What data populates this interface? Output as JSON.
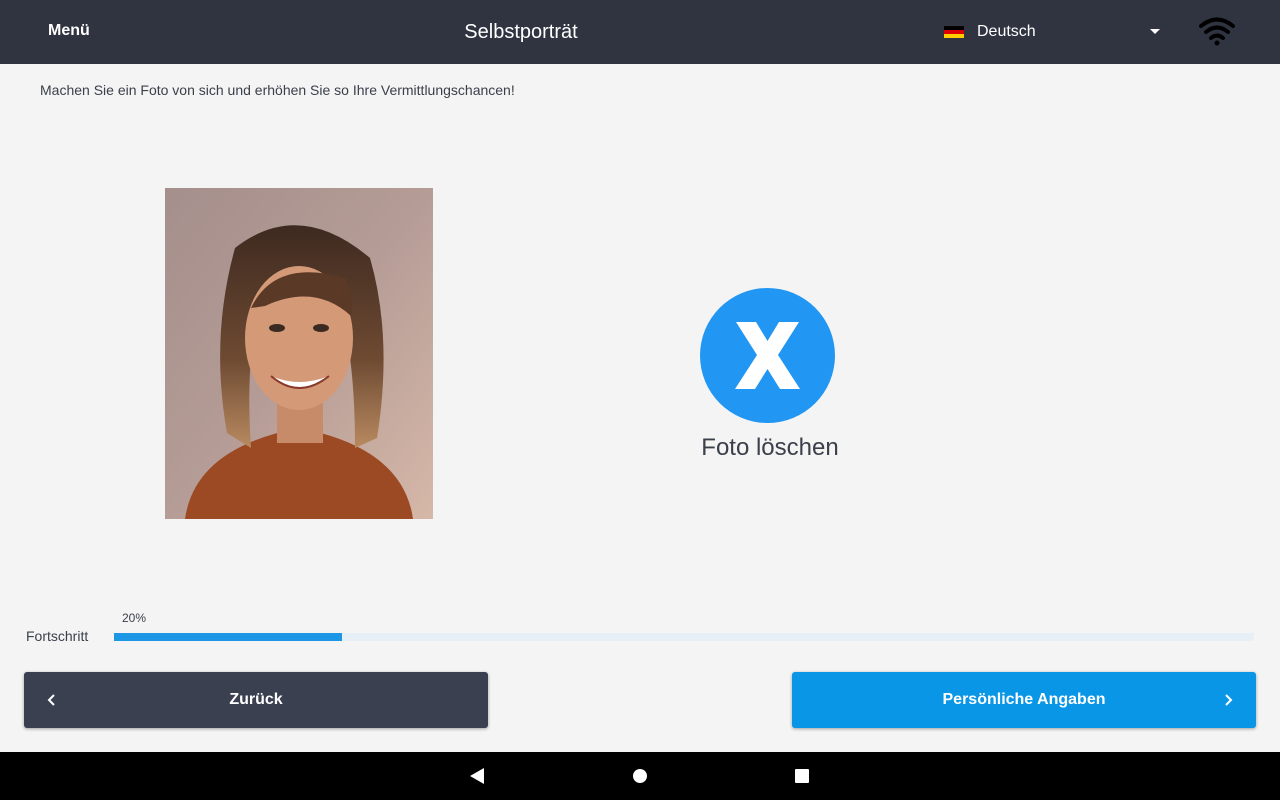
{
  "header": {
    "menu_label": "Menü",
    "title": "Selbstporträt",
    "language": {
      "label": "Deutsch",
      "flag_icon": "germany-flag-icon"
    },
    "wifi_icon": "wifi-icon"
  },
  "main": {
    "intro_text": "Machen Sie ein Foto von sich und erhöhen Sie so Ihre Vermittlungschancen!",
    "photo": {
      "alt": "Selbstporträt"
    },
    "delete_photo": {
      "icon": "delete-x-icon",
      "label": "Foto löschen"
    }
  },
  "progress": {
    "label": "Fortschritt",
    "percent_text": "20%",
    "value": 0.2
  },
  "buttons": {
    "back_label": "Zurück",
    "next_label": "Persönliche Angaben"
  },
  "system_nav": {
    "back_icon": "nav-back-icon",
    "home_icon": "nav-home-icon",
    "recents_icon": "nav-recents-icon"
  },
  "colors": {
    "topbar": "#2f3440",
    "accent": "#0a96e6",
    "delete_circle": "#2196f3",
    "back_button": "#3b4050"
  }
}
